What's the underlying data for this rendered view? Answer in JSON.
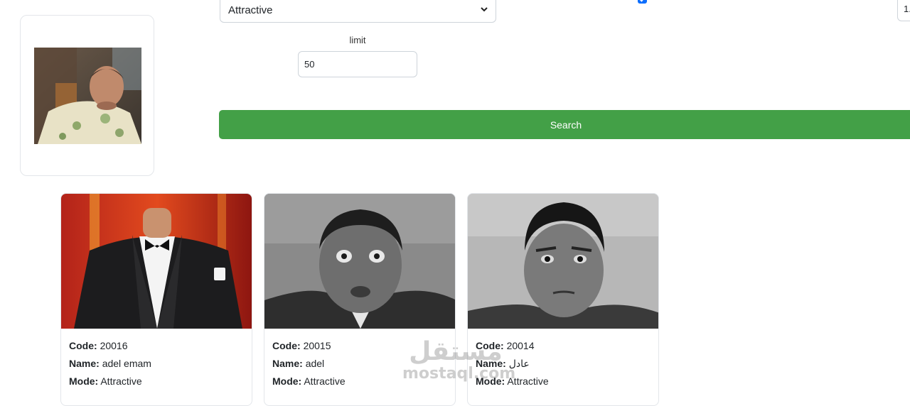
{
  "filters": {
    "mode_value": "Attractive",
    "limit_label": "limit",
    "limit_value": "50",
    "right_field_value": "1.",
    "checkbox_checked": true
  },
  "actions": {
    "search_label": "Search"
  },
  "results": [
    {
      "code_label": "Code:",
      "code": "20016",
      "name_label": "Name:",
      "name": "adel emam",
      "mode_label": "Mode:",
      "mode": "Attractive"
    },
    {
      "code_label": "Code:",
      "code": "20015",
      "name_label": "Name:",
      "name": "adel",
      "mode_label": "Mode:",
      "mode": "Attractive"
    },
    {
      "code_label": "Code:",
      "code": "20014",
      "name_label": "Name:",
      "name": "عادل",
      "mode_label": "Mode:",
      "mode": "Attractive"
    }
  ],
  "watermark": {
    "arabic": "مستقل",
    "latin": "mostaql.com"
  },
  "colors": {
    "search_button": "#43a047",
    "checkbox": "#0d6efd"
  }
}
